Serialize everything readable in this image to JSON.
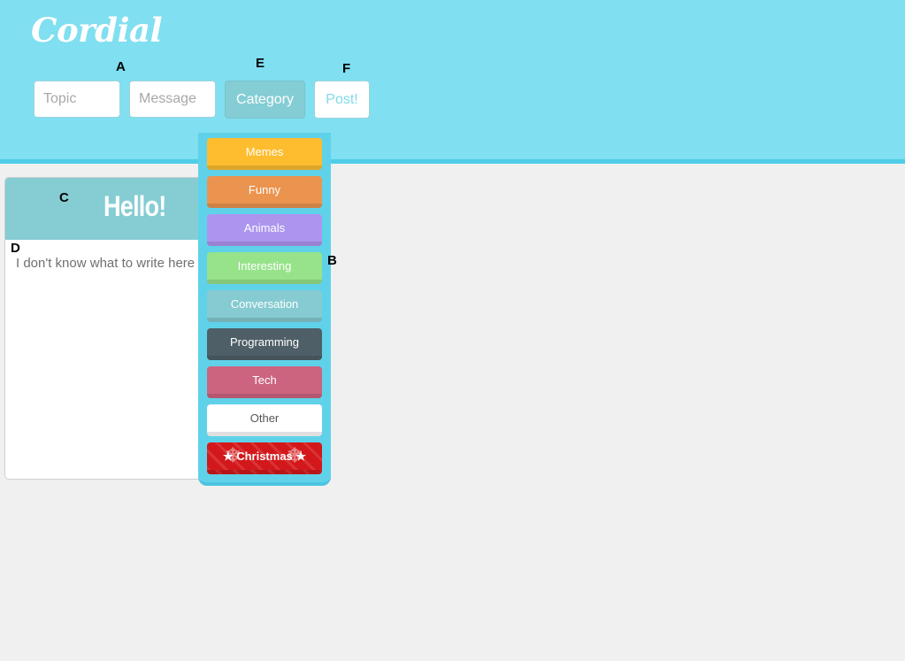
{
  "app": {
    "logo": "Cordial"
  },
  "markers": {
    "a": "A",
    "b": "B",
    "c": "C",
    "d": "D",
    "e": "E",
    "f": "F"
  },
  "form": {
    "topic_placeholder": "Topic",
    "message_placeholder": "Message",
    "category_label": "Category",
    "post_label": "Post!"
  },
  "categories": [
    {
      "label": "Memes",
      "color": "#fdbd2f"
    },
    {
      "label": "Funny",
      "color": "#eb9450"
    },
    {
      "label": "Animals",
      "color": "#ad95ee"
    },
    {
      "label": "Interesting",
      "color": "#97e38a"
    },
    {
      "label": "Conversation",
      "color": "#86cbd1"
    },
    {
      "label": "Programming",
      "color": "#4f5f67"
    },
    {
      "label": "Tech",
      "color": "#cc6480"
    },
    {
      "label": "Other",
      "color": "#ffffff"
    },
    {
      "label": "★ Christmas ★",
      "color": "#d3181b"
    }
  ],
  "post": {
    "title": "Hello!",
    "body": "I don't know what to write here"
  },
  "colors": {
    "header": "#80dff0",
    "header_border": "#4fcde6",
    "background": "#f0f0f0",
    "card_header": "#85ccd3"
  }
}
